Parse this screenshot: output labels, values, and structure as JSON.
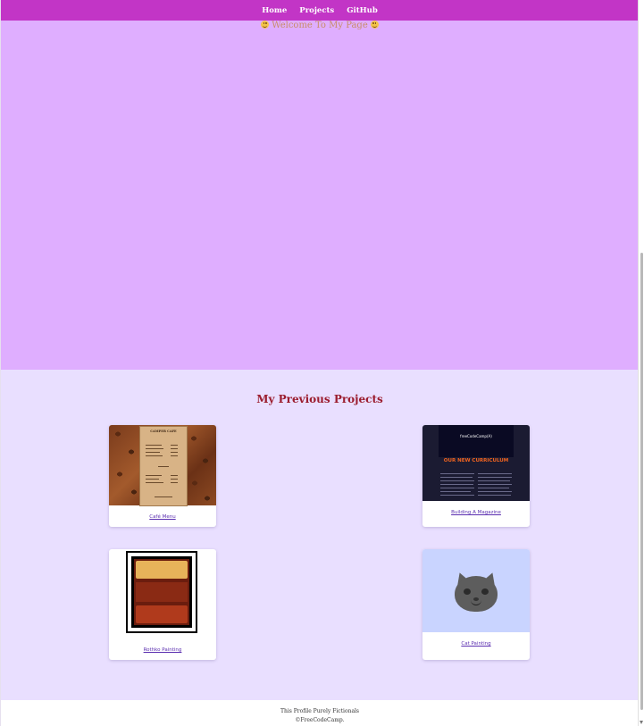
{
  "nav": {
    "links": [
      {
        "label": "Home"
      },
      {
        "label": "Projects"
      },
      {
        "label": "GitHub"
      }
    ]
  },
  "welcome": {
    "title": "Welcome To My Page",
    "emoji": "smiling-face"
  },
  "projects": {
    "heading": "My Previous Projects",
    "cards": [
      {
        "label": "Café Menu",
        "thumb_title": "CAMPER CAFE"
      },
      {
        "label": "Building A Magazine",
        "thumb_brand": "freeCodeCamp(A)",
        "thumb_headline": "OUR NEW CURRICULUM"
      },
      {
        "label": "Rothko Painting"
      },
      {
        "label": "Cat Painting"
      }
    ]
  },
  "footer": {
    "line1": "This Profile Purely Fictionals",
    "line2": "©FreeCodeCamp."
  },
  "colors": {
    "navbar": "#c235c6",
    "welcome_bg": "#dfaeff",
    "projects_bg": "#e9dfff",
    "heading": "#9b1c2e"
  }
}
